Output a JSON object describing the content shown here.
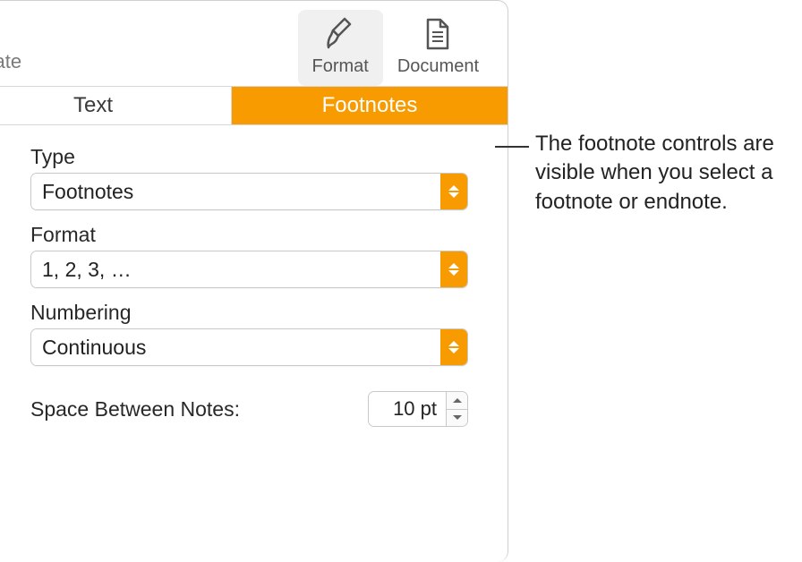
{
  "toolbar": {
    "collaborate_fragment": "orate",
    "format_label": "Format",
    "document_label": "Document"
  },
  "tabs": {
    "text": "Text",
    "footnotes": "Footnotes"
  },
  "fields": {
    "type": {
      "label": "Type",
      "value": "Footnotes"
    },
    "format": {
      "label": "Format",
      "value": "1, 2, 3, …"
    },
    "numbering": {
      "label": "Numbering",
      "value": "Continuous"
    },
    "spacing": {
      "label": "Space Between Notes:",
      "value": "10 pt"
    }
  },
  "callout": "The footnote controls are visible when you select a footnote or endnote."
}
